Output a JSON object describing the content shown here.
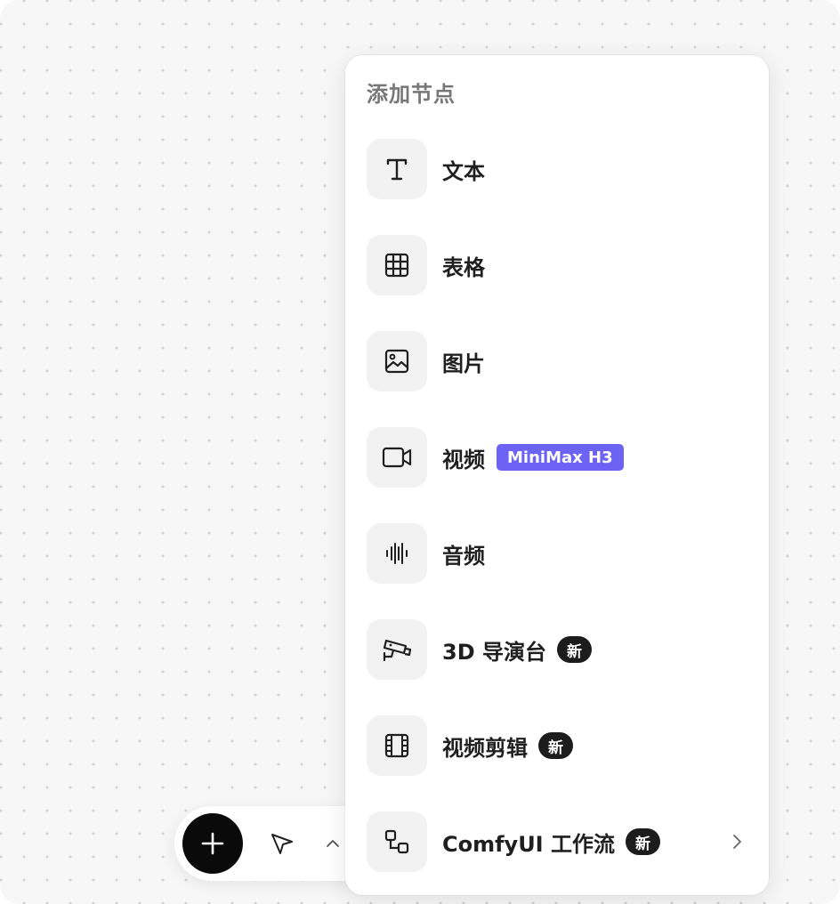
{
  "menu": {
    "title": "添加节点",
    "items": [
      {
        "label": "文本",
        "icon": "text-t-icon"
      },
      {
        "label": "表格",
        "icon": "table-grid-icon"
      },
      {
        "label": "图片",
        "icon": "image-icon"
      },
      {
        "label": "视频",
        "icon": "video-camera-icon",
        "badge": "MiniMax H3"
      },
      {
        "label": "音频",
        "icon": "audio-waveform-icon"
      },
      {
        "label": "3D 导演台",
        "icon": "cctv-camera-icon",
        "badge": "新"
      },
      {
        "label": "视频剪辑",
        "icon": "film-strip-icon",
        "badge": "新"
      },
      {
        "label": "ComfyUI 工作流",
        "icon": "workflow-nodes-icon",
        "badge": "新",
        "has_submenu": true
      }
    ]
  },
  "toolbar": {
    "add_icon": "plus-icon",
    "pointer_icon": "cursor-arrow-icon",
    "expand_icon": "chevron-up-icon"
  },
  "colors": {
    "model_badge": "#6c63f5",
    "new_badge": "#1c1c1c",
    "add_button": "#0a0a0a",
    "icon_tile": "#f2f2f2"
  }
}
